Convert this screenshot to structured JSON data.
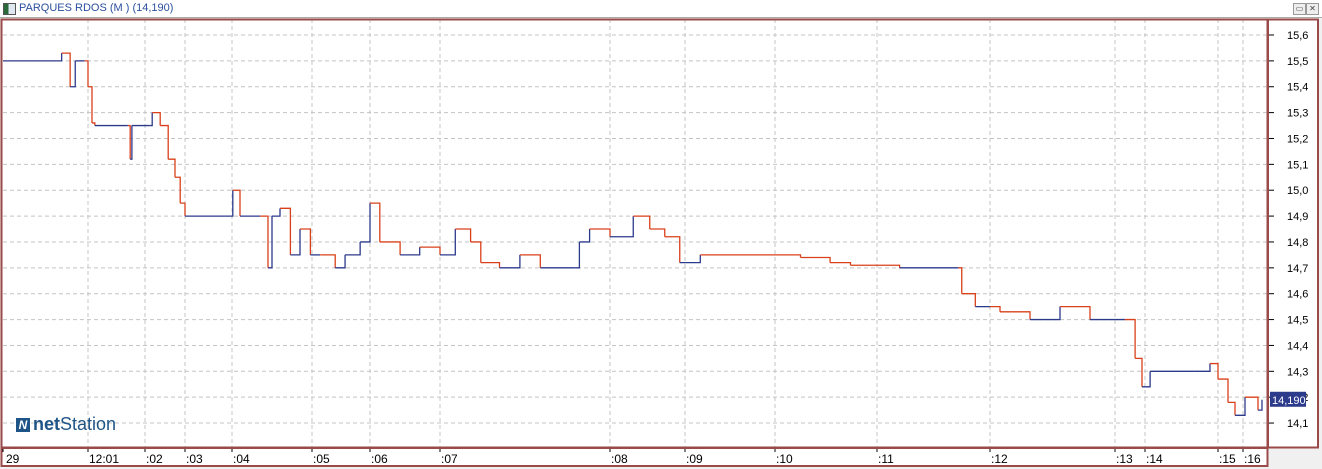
{
  "window": {
    "title": "PARQUES RDOS (M ) (14,190)",
    "restore_label": "▭",
    "close_label": "✕"
  },
  "logo": {
    "text_bold": "net",
    "text": "Station"
  },
  "chart_data": {
    "type": "line",
    "title": "PARQUES RDOS (M ) (14,190)",
    "last_price_label": "14,190",
    "last_price": 14.19,
    "ylim": [
      14.05,
      15.65
    ],
    "y_ticks": [
      15.6,
      15.5,
      15.4,
      15.3,
      15.2,
      15.1,
      15.0,
      14.9,
      14.8,
      14.7,
      14.6,
      14.5,
      14.4,
      14.3,
      14.2,
      14.1
    ],
    "y_tick_labels": [
      "15,6",
      "15,5",
      "15,4",
      "15,3",
      "15,2",
      "15,1",
      "15,0",
      "14,9",
      "14,8",
      "14,7",
      "14,6",
      "14,5",
      "14,4",
      "14,3",
      "14,2",
      "14,1"
    ],
    "x_ticks": [
      0,
      1,
      2,
      3,
      4,
      5,
      6,
      7,
      8,
      9,
      10,
      11,
      12,
      13,
      14,
      15,
      16
    ],
    "x_tick_labels": [
      "29",
      "12:01",
      ":02",
      ":03",
      ":04",
      ":05",
      ":06",
      ":07",
      ":08",
      ":09",
      ":10",
      ":11",
      ":12",
      ":13",
      ":14",
      ":15",
      ":16"
    ],
    "grid": true,
    "colors": {
      "up": "#2c3a8c",
      "down": "#d9401a",
      "frame": "#9b4a4a",
      "badge": "#2c3a8c"
    },
    "points": [
      [
        0,
        15.5
      ],
      [
        0.67,
        15.5
      ],
      [
        0.69,
        15.53
      ],
      [
        0.79,
        15.4
      ],
      [
        0.85,
        15.5
      ],
      [
        0.96,
        15.5
      ],
      [
        1,
        15.4
      ],
      [
        1.07,
        15.26
      ],
      [
        1.12,
        15.25
      ],
      [
        1.7,
        15.25
      ],
      [
        1.74,
        15.12
      ],
      [
        1.77,
        15.25
      ],
      [
        2.12,
        15.25
      ],
      [
        2.18,
        15.3
      ],
      [
        2.38,
        15.25
      ],
      [
        2.58,
        15.12
      ],
      [
        2.75,
        15.05
      ],
      [
        2.88,
        14.95
      ],
      [
        3,
        14.9
      ],
      [
        3.96,
        14.9
      ],
      [
        4.01,
        15.0
      ],
      [
        4.1,
        14.9
      ],
      [
        4.35,
        14.9
      ],
      [
        4.45,
        14.7
      ],
      [
        4.5,
        14.9
      ],
      [
        4.6,
        14.93
      ],
      [
        4.73,
        14.75
      ],
      [
        4.85,
        14.85
      ],
      [
        4.98,
        14.75
      ],
      [
        5.14,
        14.75
      ],
      [
        5.4,
        14.7
      ],
      [
        5.57,
        14.75
      ],
      [
        5.83,
        14.8
      ],
      [
        6,
        14.95
      ],
      [
        6.14,
        14.8
      ],
      [
        6.43,
        14.75
      ],
      [
        6.71,
        14.78
      ],
      [
        7,
        14.75
      ],
      [
        7.09,
        14.85
      ],
      [
        7.18,
        14.8
      ],
      [
        7.24,
        14.72
      ],
      [
        7.35,
        14.7
      ],
      [
        7.47,
        14.75
      ],
      [
        7.59,
        14.7
      ],
      [
        7.79,
        14.7
      ],
      [
        7.82,
        14.8
      ],
      [
        7.88,
        14.85
      ],
      [
        8,
        14.82
      ],
      [
        8.31,
        14.9
      ],
      [
        8.53,
        14.85
      ],
      [
        8.73,
        14.82
      ],
      [
        8.93,
        14.72
      ],
      [
        9.17,
        14.75
      ],
      [
        10.25,
        14.74
      ],
      [
        10.54,
        14.72
      ],
      [
        10.74,
        14.71
      ],
      [
        11.2,
        14.7
      ],
      [
        11.72,
        14.7
      ],
      [
        11.75,
        14.6
      ],
      [
        11.87,
        14.55
      ],
      [
        12,
        14.55
      ],
      [
        12.08,
        14.53
      ],
      [
        12.32,
        14.5
      ],
      [
        12.56,
        14.55
      ],
      [
        12.8,
        14.5
      ],
      [
        13.33,
        14.5
      ],
      [
        13.67,
        14.35
      ],
      [
        13.9,
        14.24
      ],
      [
        14.07,
        14.3
      ],
      [
        14.68,
        14.3
      ],
      [
        14.89,
        14.33
      ],
      [
        15,
        14.27
      ],
      [
        15.4,
        14.18
      ],
      [
        15.68,
        14.13
      ],
      [
        16.08,
        14.2
      ],
      [
        16.6,
        14.15
      ],
      [
        16.76,
        14.19
      ]
    ]
  }
}
